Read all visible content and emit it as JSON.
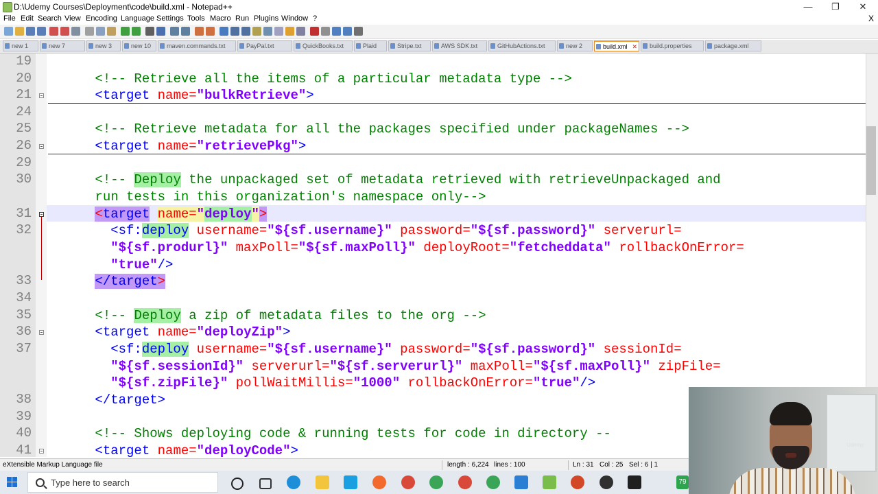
{
  "window": {
    "title": "D:\\Udemy Courses\\Deployment\\code\\build.xml - Notepad++",
    "controls": {
      "minimize": "—",
      "maximize": "❐",
      "close": "✕"
    }
  },
  "menu": {
    "items": [
      "File",
      "Edit",
      "Search",
      "View",
      "Encoding",
      "Language",
      "Settings",
      "Tools",
      "Macro",
      "Run",
      "Plugins",
      "Window",
      "?"
    ],
    "close": "X"
  },
  "tabs": [
    {
      "label": "new 1"
    },
    {
      "label": "new 7"
    },
    {
      "label": "new 3"
    },
    {
      "label": "new 10"
    },
    {
      "label": "maven.commands.txt"
    },
    {
      "label": "PayPal.txt"
    },
    {
      "label": "QuickBooks.txt"
    },
    {
      "label": "Plaid"
    },
    {
      "label": "Stripe.txt"
    },
    {
      "label": "AWS SDK.txt"
    },
    {
      "label": "GitHubActions.txt"
    },
    {
      "label": "new 2"
    },
    {
      "label": "build.xml",
      "active": true
    },
    {
      "label": "build.properties"
    },
    {
      "label": "package.xml"
    }
  ],
  "editor": {
    "line_numbers": [
      "19",
      "20",
      "21",
      "24",
      "25",
      "26",
      "29",
      "30",
      "",
      "31",
      "32",
      "",
      "",
      "33",
      "34",
      "35",
      "36",
      "37",
      "",
      "",
      "38",
      "39",
      "40",
      "41"
    ],
    "lines": {
      "l20": {
        "a": "<!-- Retrieve all the items of a particular metadata type -->"
      },
      "l21": {
        "a": "<target ",
        "b": "name=",
        "c": "\"bulkRetrieve\"",
        "d": ">"
      },
      "l25": {
        "a": "<!-- Retrieve metadata for all the packages specified under packageNames -->"
      },
      "l26": {
        "a": "<target ",
        "b": "name=",
        "c": "\"retrievePkg\"",
        "d": ">"
      },
      "l30a": {
        "a": "<!-- ",
        "b": "Deploy",
        "c": " the unpackaged set of metadata retrieved with retrieveUnpackaged and"
      },
      "l30b": {
        "a": "run tests in this organization's namespace only-->"
      },
      "l31": {
        "a": "<",
        "b": "target",
        "c": " ",
        "d": "name=",
        "e": "\"",
        "f": "deploy",
        "g": "\"",
        "h": ">"
      },
      "l32a": {
        "a": "<sf:",
        "b": "deploy",
        "c": " username=",
        "d": "\"${sf.username}\"",
        "e": " password=",
        "f": "\"${sf.password}\"",
        "g": " serverurl="
      },
      "l32b": {
        "a": "\"${sf.produrl}\"",
        "b": " maxPoll=",
        "c": "\"${sf.maxPoll}\"",
        "d": " deployRoot=",
        "e": "\"fetcheddata\"",
        "f": " rollbackOnError="
      },
      "l32c": {
        "a": "\"true\"",
        "b": "/>"
      },
      "l33": {
        "a": "</target",
        "b": ">"
      },
      "l35": {
        "a": "<!-- ",
        "b": "Deploy",
        "c": " a zip of metadata files to the org -->"
      },
      "l36": {
        "a": "<target ",
        "b": "name=",
        "c": "\"deployZip\"",
        "d": ">"
      },
      "l37a": {
        "a": "<sf:",
        "b": "deploy",
        "c": " username=",
        "d": "\"${sf.username}\"",
        "e": " password=",
        "f": "\"${sf.password}\"",
        "g": " sessionId="
      },
      "l37b": {
        "a": "\"${sf.sessionId}\"",
        "b": " serverurl=",
        "c": "\"${sf.serverurl}\"",
        "d": " maxPoll=",
        "e": "\"${sf.maxPoll}\"",
        "f": " zipFile="
      },
      "l37c": {
        "a": "\"${sf.zipFile}\"",
        "b": " pollWaitMillis=",
        "c": "\"1000\"",
        "d": " rollbackOnError=",
        "e": "\"true\"",
        "f": "/>"
      },
      "l38": {
        "a": "</target>"
      },
      "l40": {
        "a": "<!-- Shows deploying code & running tests for code in directory --"
      },
      "l41": {
        "a": "<target ",
        "b": "name=",
        "c": "\"deployCode\"",
        "d": ">"
      }
    }
  },
  "status": {
    "file_type": "eXtensible Markup Language file",
    "length": "length : 6,224",
    "lines": "lines : 100",
    "ln": "Ln : 31",
    "col": "Col : 25",
    "sel": "Sel : 6 | 1"
  },
  "taskbar": {
    "search_placeholder": "Type here to search",
    "app_icons": [
      "cortana-circle",
      "task-view",
      "edge",
      "file-explorer",
      "l-app",
      "paint",
      "chrome",
      "chrome",
      "chrome",
      "chrome",
      "vscode",
      "notepadpp",
      "powerpoint",
      "obs",
      "terminal"
    ],
    "tray_badge": "79"
  },
  "webcam": {
    "watermark": "Udemy"
  }
}
